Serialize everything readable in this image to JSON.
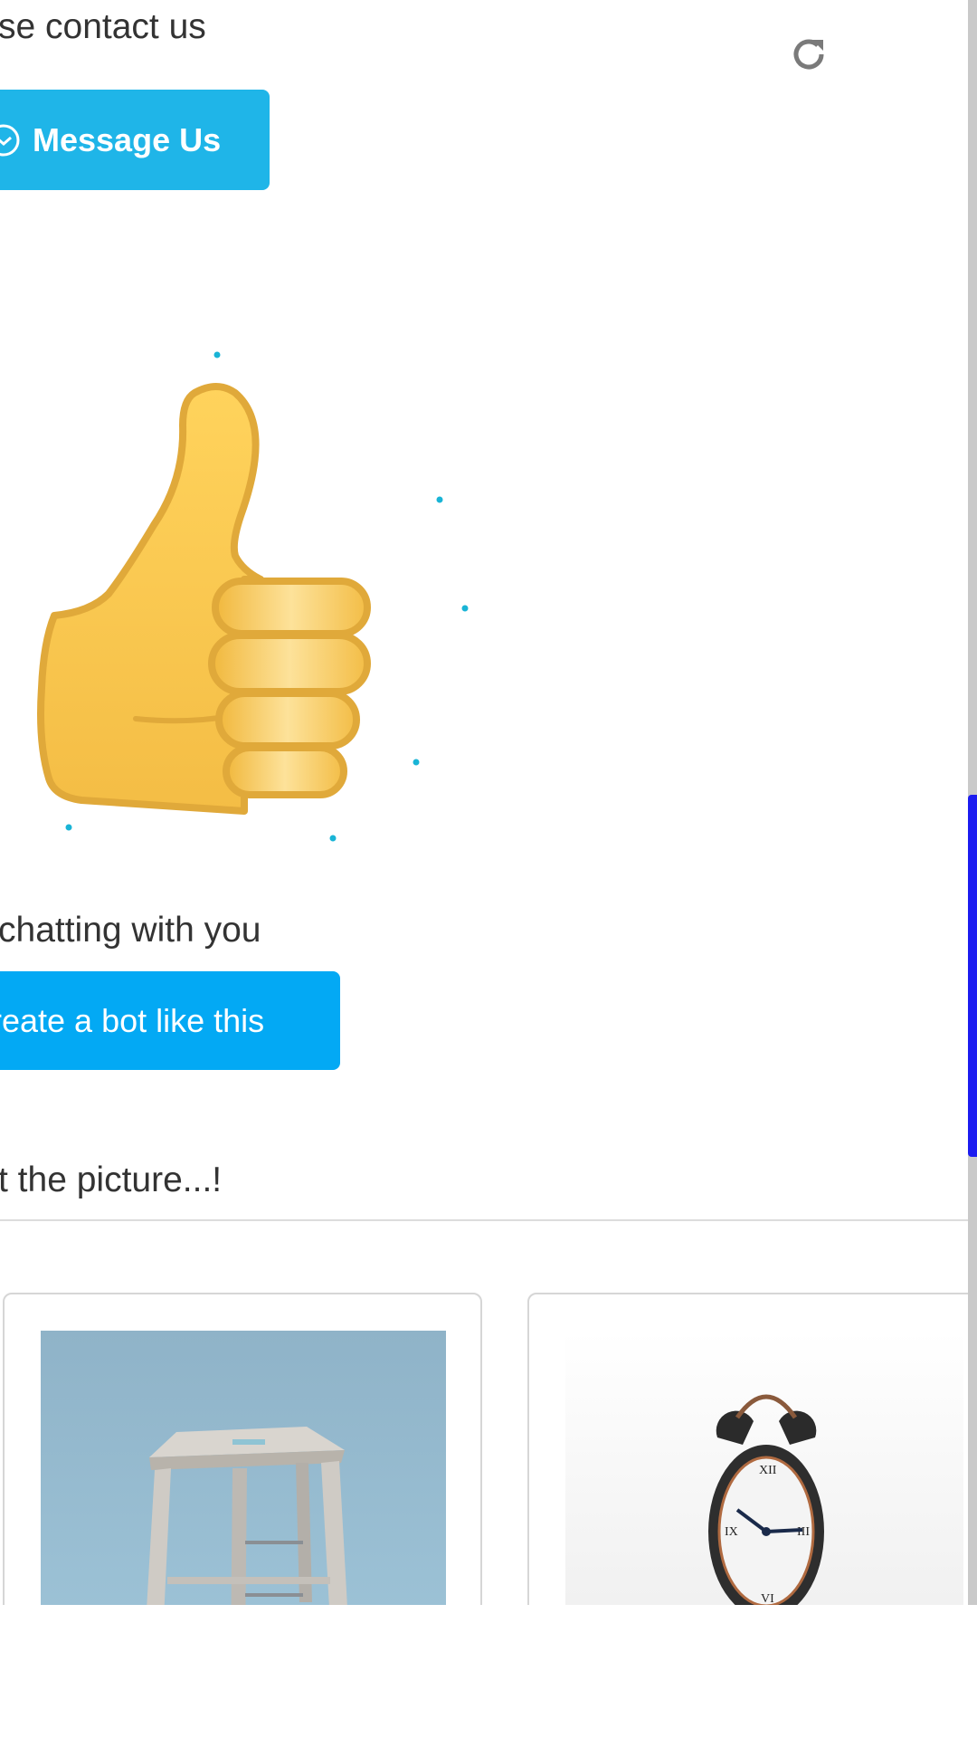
{
  "messages": {
    "contact_text": "se contact us",
    "chatting_text": "chatting with you",
    "picture_prompt": "t the picture...!"
  },
  "buttons": {
    "message_us": "Message Us",
    "create_bot": "reate a bot like this"
  },
  "icons": {
    "refresh": "refresh-icon",
    "message_us": "check-circle-icon",
    "thumbs_up": "thumbs-up-emoji"
  },
  "cards": [
    {
      "image": "stool-image"
    },
    {
      "image": "alarm-clock-image"
    }
  ],
  "colors": {
    "message_us_bg": "#1fb5e8",
    "create_bot_bg": "#03a9f4",
    "scroll_thumb": "#1c1cf0",
    "text": "#333333"
  }
}
